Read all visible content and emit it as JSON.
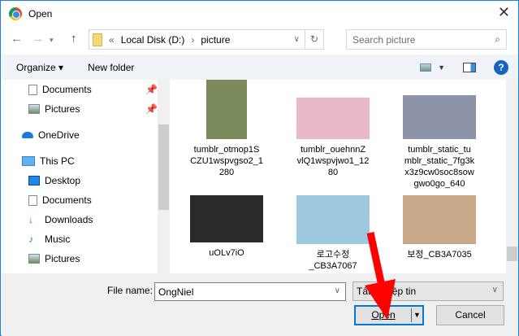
{
  "window": {
    "title": "Open",
    "close": "✕"
  },
  "address": {
    "prefix": "«",
    "segments": [
      "Local Disk (D:)",
      "picture"
    ],
    "separator": "›"
  },
  "search": {
    "placeholder": "Search picture"
  },
  "toolbar": {
    "organize": "Organize ▾",
    "new_folder": "New folder",
    "help": "?"
  },
  "sidebar": {
    "items": [
      {
        "label": "Documents",
        "icon": "documents-icon",
        "pinned": true
      },
      {
        "label": "Pictures",
        "icon": "pictures-icon",
        "pinned": true
      },
      {
        "label": "OneDrive",
        "icon": "onedrive-icon"
      },
      {
        "label": "This PC",
        "icon": "pc-icon"
      },
      {
        "label": "Desktop",
        "icon": "desktop-icon"
      },
      {
        "label": "Documents",
        "icon": "documents-icon"
      },
      {
        "label": "Downloads",
        "icon": "downloads-icon"
      },
      {
        "label": "Music",
        "icon": "music-icon"
      },
      {
        "label": "Pictures",
        "icon": "pictures-icon"
      }
    ]
  },
  "files": [
    {
      "name": "tumblr_otmop1SCZU1wspvgso2_1280",
      "lines": [
        "tumblr_otmop1S",
        "CZU1wspvgso2_1",
        "280"
      ],
      "color": "#7a8a5a"
    },
    {
      "name": "tumblr_ouehnnZvlQ1wspvjwo1_1280",
      "lines": [
        "tumblr_ouehnnZ",
        "vlQ1wspvjwo1_12",
        "80"
      ],
      "color": "#e9b9c9"
    },
    {
      "name": "tumblr_static_tumblr_static_7fg3kx3z9cw0soc8sowgwo0go_640",
      "lines": [
        "tumblr_static_tu",
        "mblr_static_7fg3k",
        "x3z9cw0soc8sow",
        "gwo0go_640"
      ],
      "color": "#8d93a8"
    },
    {
      "name": "uOLv7iO",
      "lines": [
        "uOLv7iO"
      ],
      "color": "#2a2a2a"
    },
    {
      "name": "로고수정_CB3A7067",
      "lines": [
        "로고수정",
        "_CB3A7067"
      ],
      "color": "#9ec7e0"
    },
    {
      "name": "보정_CB3A7035",
      "lines": [
        "보정_CB3A7035"
      ],
      "color": "#c9a98a"
    }
  ],
  "footer": {
    "file_name_label": "File name:",
    "file_name_value": "OngNiel",
    "file_type": "Tất cả Tệp tin",
    "open": "Open",
    "cancel": "Cancel"
  },
  "colors": {
    "accent": "#0078d7",
    "arrow": "#ff0000"
  }
}
